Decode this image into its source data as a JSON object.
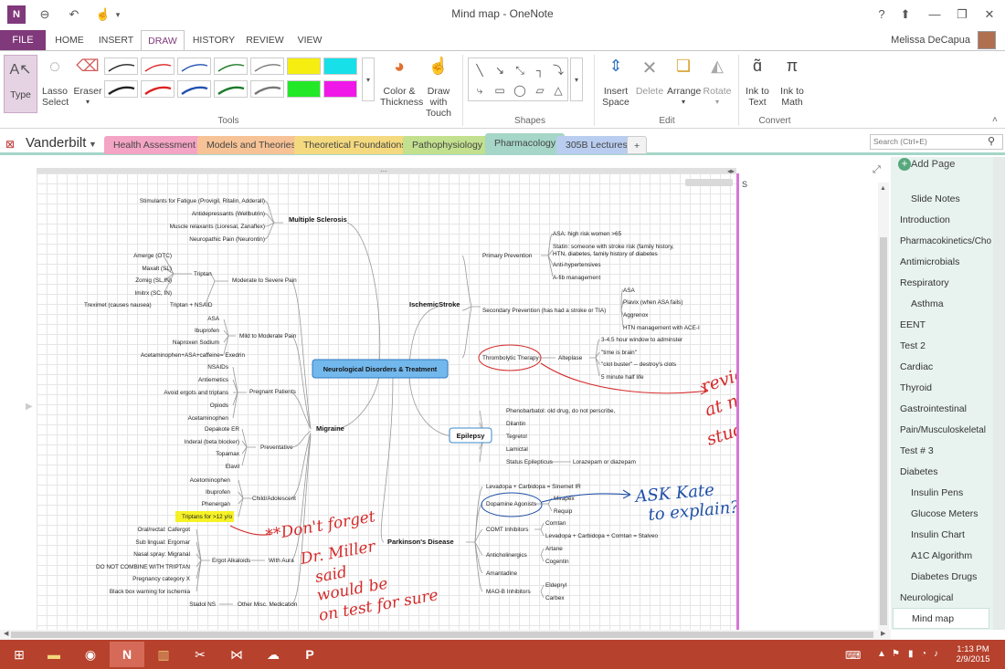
{
  "window": {
    "title": "Mind map - OneNote",
    "user": "Melissa DeCapua"
  },
  "tabs": [
    "FILE",
    "HOME",
    "INSERT",
    "DRAW",
    "HISTORY",
    "REVIEW",
    "VIEW"
  ],
  "ribbon": {
    "type": "Type",
    "lasso": [
      "Lasso",
      "Select"
    ],
    "eraser": "Eraser",
    "color": [
      "Color &",
      "Thickness"
    ],
    "drawtouch": [
      "Draw with",
      "Touch"
    ],
    "insertspace": [
      "Insert",
      "Space"
    ],
    "delete": "Delete",
    "arrange": "Arrange",
    "rotate": "Rotate",
    "inktext": [
      "Ink to",
      "Text"
    ],
    "inkmath": [
      "Ink to",
      "Math"
    ],
    "groups": [
      "Tools",
      "Shapes",
      "Edit",
      "Convert"
    ]
  },
  "notebook": {
    "name": "Vanderbilt",
    "sections": [
      "Health Assessment",
      "Models and Theories",
      "Theoretical Foundations",
      "Pathophysiology",
      "Pharmacology",
      "305B Lectures",
      "+"
    ]
  },
  "search": {
    "placeholder": "Search (Ctrl+E)"
  },
  "pages": {
    "add": "Add Page",
    "items": [
      "Slide Notes",
      "Introduction",
      "Pharmacokinetics/Cho",
      "Antimicrobials",
      "Respiratory",
      "Asthma",
      "EENT",
      "Test 2",
      "Cardiac",
      "Thyroid",
      "Gastrointestinal",
      "Pain/Musculoskeletal",
      "Test # 3",
      "Diabetes",
      "Insulin Pens",
      "Glucose Meters",
      "Insulin Chart",
      "A1C Algorithm",
      "Diabetes Drugs",
      "Neurological",
      "Mind map"
    ]
  },
  "mindmap": {
    "center": "Neurological Disorders & Treatment",
    "ms": {
      "label": "Multiple Sclerosis",
      "items": [
        "Stimulants for Fatigue (Provigil, Ritalin, Adderall)",
        "Antidepressants (Wellbutrin)",
        "Muscle relaxants (Lioresal, Zanaflex)",
        "Neuropathic Pain (Neurontin)"
      ]
    },
    "migraine": {
      "label": "Migraine",
      "severe": "Moderate to Severe Pain",
      "triptan": "Triptan",
      "triptanItems": [
        "Amerge (OTC)",
        "Maxalt (SL)",
        "Zomig (SL,IN)",
        "Imitrx (SC, IN)"
      ],
      "nsaid": "Triptan + NSAID",
      "treximet": "Treximet (causes nausea)",
      "mild": "Mild to Moderate Pain",
      "mildItems": [
        "ASA",
        "Ibuprofen",
        "Naproxen Sodium",
        "Acetaminophen+ASA+caffeine= Exedrin"
      ],
      "pregnant": "Pregnant Patients",
      "pregItems": [
        "NSAIDs",
        "Antiemetics",
        "Avoid ergots and triptans",
        "Opiods",
        "Acetaminophen"
      ],
      "prev": "Preventative",
      "prevItems": [
        "Depakote ER",
        "Inderal (beta blocker)",
        "Topamax",
        "Elavil"
      ],
      "child": "Child/Adolescent",
      "childItems": [
        "Acetominophen",
        "Ibuprofen",
        "Phenergan",
        "Triptans for >12 y/o"
      ],
      "aura": "With Aura",
      "ergot": "Ergot Alkaloids",
      "ergotItems": [
        "Oral/rectal: Cafergot",
        "Sub lingual: Ergomar",
        "Nasal spray: Migranal",
        "DO NOT COMBINE WITH TRIPTAN",
        "Pregnancy category X",
        "Black box warning for ischemia"
      ],
      "misc": "Other Misc. Medication",
      "miscItems": [
        "Stadol NS"
      ]
    },
    "stroke": {
      "label": "IschemicStroke",
      "primary": "Primary Prevention",
      "primaryItems": [
        "ASA: high risk women >65",
        "Statin: someone with stroke risk (family history,",
        "HTN, diabetes, family history of diabetes",
        "Anti-hypertensives",
        "A-fib management"
      ],
      "secondary": "Secondary Prevention (has had a stroke or TIA)",
      "secondaryItems": [
        "ASA",
        "Plavix (when ASA fails)",
        "Aggrenox",
        "HTN management with ACE-I"
      ],
      "thromb": "Thrombolytic Therapy",
      "alteplase": "Alteplase",
      "altItems": [
        "3-4.5 hour window to adminster",
        "\"time is brain\"",
        "\"clot buster\" -- destroy's clots",
        "5 minute half life"
      ]
    },
    "epilepsy": {
      "label": "Epilepsy",
      "items": [
        "Phenobarbatol: old drug, do not perscribe,",
        "Dilantin",
        "Tegretol",
        "Lamictal",
        "Status Epilepticus"
      ],
      "status": "Lorazepam or diazepam"
    },
    "parkinson": {
      "label": "Parkinson's Disease",
      "items": [
        "Levadopa + Carbidopa = Sinemet IR",
        "Dopamine Agonists",
        "COMT Inhibitors",
        "Anticholinergics",
        "Amantadine",
        "MAO-B Inhibitors"
      ],
      "dopa": [
        "Mirapex",
        "Requip"
      ],
      "comt": [
        "Comtan",
        "Levadopa + Carbidopa + Comtan = Stalveo"
      ],
      "antic": [
        "Artane",
        "Cogentin"
      ],
      "maob": [
        "Eldepryl",
        "Carbex"
      ]
    }
  },
  "ink": {
    "review": [
      "review",
      "at next",
      "study group"
    ],
    "ask": [
      "ASK Kate",
      "to explain??"
    ],
    "dont": [
      "**Don't forget",
      "Dr. Miller",
      "said",
      "would be",
      "on test for sure"
    ]
  },
  "tray": {
    "time": "1:13 PM",
    "date": "2/9/2015"
  },
  "colors": {
    "onenote": "#80397b",
    "taskbar": "#b6412c",
    "ink_red": "#d42a2a",
    "ink_blue": "#1e4fa8",
    "highlight": "#f5f000"
  }
}
